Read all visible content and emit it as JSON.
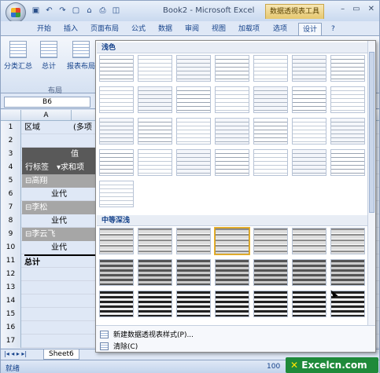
{
  "titlebar": {
    "title": "Book2 - Microsoft Excel",
    "context_tab": "数据透视表工具",
    "win_buttons": [
      "–",
      "▭",
      "✕"
    ]
  },
  "ribbon_tabs": [
    "开始",
    "插入",
    "页面布局",
    "公式",
    "数据",
    "审阅",
    "视图",
    "加载项",
    "选项",
    "设计"
  ],
  "active_tab": "设计",
  "ribbon": {
    "buttons": [
      "分类汇总",
      "总计",
      "报表布局"
    ],
    "group_label": "布局"
  },
  "name_box": "B6",
  "column_header": "A",
  "rows": [
    {
      "n": "1",
      "a": "区域",
      "b": "(多项"
    },
    {
      "n": "2",
      "a": "",
      "b": ""
    },
    {
      "n": "3",
      "a": "",
      "b": "值"
    },
    {
      "n": "4",
      "a": "行标签",
      "b": "求和项"
    },
    {
      "n": "5",
      "a": "⊟高翔",
      "b": ""
    },
    {
      "n": "6",
      "a": "业代",
      "b": ""
    },
    {
      "n": "7",
      "a": "⊟李松",
      "b": ""
    },
    {
      "n": "8",
      "a": "业代",
      "b": ""
    },
    {
      "n": "9",
      "a": "⊟李云飞",
      "b": ""
    },
    {
      "n": "10",
      "a": "业代",
      "b": ""
    },
    {
      "n": "11",
      "a": "总计",
      "b": ""
    },
    {
      "n": "12",
      "a": "",
      "b": ""
    },
    {
      "n": "13",
      "a": "",
      "b": ""
    },
    {
      "n": "14",
      "a": "",
      "b": ""
    },
    {
      "n": "15",
      "a": "",
      "b": ""
    },
    {
      "n": "16",
      "a": "",
      "b": ""
    },
    {
      "n": "17",
      "a": "",
      "b": ""
    }
  ],
  "gallery": {
    "section_light": "浅色",
    "section_medium": "中等深浅",
    "footer_new": "新建数据透视表样式(P)...",
    "footer_clear": "清除(C)"
  },
  "sheet_tab": "Sheet6",
  "status": "就绪",
  "zoom": "100",
  "logo": "Excelcn.com",
  "colors": {
    "accent": "#15428b",
    "dark_row": "#595959"
  }
}
